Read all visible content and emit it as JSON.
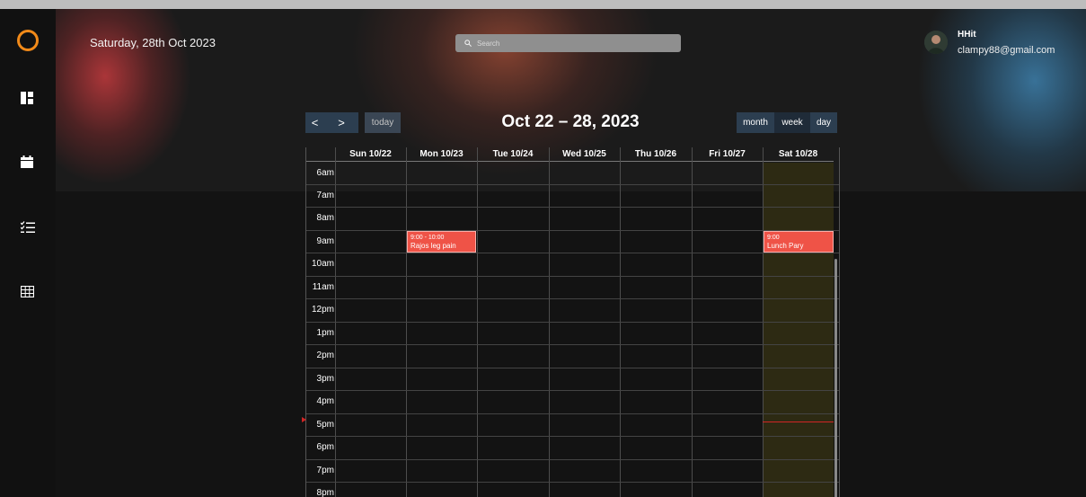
{
  "header": {
    "date": "Saturday, 28th Oct 2023",
    "search_placeholder": "Search"
  },
  "user": {
    "name": "HHit",
    "email": "clampy88@gmail.com"
  },
  "sidebar": {
    "items": [
      {
        "icon": "dashboard-icon"
      },
      {
        "icon": "calendar-icon"
      },
      {
        "icon": "checklist-icon"
      },
      {
        "icon": "table-icon"
      }
    ]
  },
  "calendar": {
    "prev_label": "<",
    "next_label": ">",
    "today_label": "today",
    "title": "Oct 22 – 28, 2023",
    "views": [
      "month",
      "week",
      "day"
    ],
    "active_view": "week",
    "columns": [
      "Sun 10/22",
      "Mon 10/23",
      "Tue 10/24",
      "Wed 10/25",
      "Thu 10/26",
      "Fri 10/27",
      "Sat 10/28"
    ],
    "times": [
      "6am",
      "7am",
      "8am",
      "9am",
      "10am",
      "11am",
      "12pm",
      "1pm",
      "2pm",
      "3pm",
      "4pm",
      "5pm",
      "6pm",
      "7pm",
      "8pm"
    ],
    "highlight_day": "Sat 10/28",
    "events": [
      {
        "day": "Mon 10/23",
        "time": "9:00 - 10:00",
        "title": "Rajos leg pain"
      },
      {
        "day": "Sat 10/28",
        "time": "9:00",
        "title": "Lunch Pary"
      }
    ]
  },
  "colors": {
    "accent": "#f28a19",
    "button": "#2c3e50",
    "event": "#ef5347",
    "today_column": "#2d2a13",
    "now_indicator": "#d02525"
  }
}
